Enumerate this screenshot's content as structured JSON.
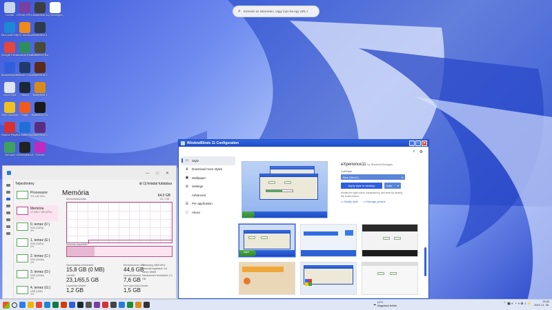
{
  "desktop": {
    "icons": [
      {
        "label": "Lomtár",
        "color": "#c9d6ea",
        "col": 0,
        "row": 0
      },
      {
        "label": "CPUID CPU-Z",
        "color": "#7a3fa0",
        "col": 1,
        "row": 0
      },
      {
        "label": "Battlefield 2",
        "color": "#3d3d3d",
        "col": 2,
        "row": 0
      },
      {
        "label": "Új Szöveges dokumentum",
        "color": "#ffffff",
        "col": 3,
        "row": 0
      },
      {
        "label": "Microsoft Edge",
        "color": "#1e88d6",
        "col": 0,
        "row": 1
      },
      {
        "label": "VLC media player",
        "color": "#f08a1d",
        "col": 1,
        "row": 1
      },
      {
        "label": "Battlefield 4",
        "color": "#2e3b4a",
        "col": 2,
        "row": 1
      },
      {
        "label": "Google Chrome",
        "color": "#e6453a",
        "col": 0,
        "row": 2
      },
      {
        "label": "Acrobat Reader",
        "color": "#2f8f5a",
        "col": 1,
        "row": 2
      },
      {
        "label": "Battlefield Bad Company",
        "color": "#4a4a3a",
        "col": 2,
        "row": 2
      },
      {
        "label": "Malwarebytes",
        "color": "#2f5fdc",
        "col": 0,
        "row": 3
      },
      {
        "label": "Ubisoft Connect",
        "color": "#1f3b6a",
        "col": 1,
        "row": 3
      },
      {
        "label": "Battlefield V",
        "color": "#5a2a1a",
        "col": 2,
        "row": 3
      },
      {
        "label": "Linux Mint",
        "color": "#dfe5ee",
        "col": 0,
        "row": 4
      },
      {
        "label": "Steam",
        "color": "#1b2838",
        "col": 1,
        "row": 4
      },
      {
        "label": "Battlefield 1",
        "color": "#d88a1a",
        "col": 2,
        "row": 4
      },
      {
        "label": "Stern Autoloader",
        "color": "#f0c020",
        "col": 0,
        "row": 5
      },
      {
        "label": "Origin",
        "color": "#f25a1b",
        "col": 1,
        "row": 5
      },
      {
        "label": "Battlefield 2042",
        "color": "#1a1a1a",
        "col": 2,
        "row": 5
      },
      {
        "label": "Roblox Player",
        "color": "#d93030",
        "col": 0,
        "row": 6
      },
      {
        "label": "EA Battlefront",
        "color": "#1f6fd6",
        "col": 1,
        "row": 6
      },
      {
        "label": "Battlefield V",
        "color": "#5b2d82",
        "col": 2,
        "row": 6
      },
      {
        "label": "Jail card",
        "color": "#3fa060",
        "col": 0,
        "row": 7
      },
      {
        "label": "Windowblinds",
        "color": "#222222",
        "col": 1,
        "row": 7
      },
      {
        "label": "Fences",
        "color": "#c02ac0",
        "col": 2,
        "row": 7
      }
    ]
  },
  "search": {
    "placeholder": "Keresés az interneten, vagy írjon be egy URL-t"
  },
  "taskmgr": {
    "title": "Teljesítmény",
    "run_task": "Új feladat futtatása",
    "items": [
      {
        "name": "Processzor",
        "sub1": "2%  4,82 GHz",
        "sub2": ""
      },
      {
        "name": "Memória",
        "sub1": "17,0/63,7 GB (27%)",
        "sub2": ""
      },
      {
        "name": "0. lemez (F:)",
        "sub1": "SSD (SATA)",
        "sub2": "0%"
      },
      {
        "name": "1. lemez (E:)",
        "sub1": "SSD (SATA)",
        "sub2": "0%"
      },
      {
        "name": "2. lemez (C:)",
        "sub1": "SSD (NVMe)",
        "sub2": "1%"
      },
      {
        "name": "3. lemez (D:)",
        "sub1": "SSD (NVMe)",
        "sub2": "0%"
      },
      {
        "name": "4. lemez (G:)",
        "sub1": "USB (USB)",
        "sub2": "0%"
      },
      {
        "name": "5. lemez (I:)",
        "sub1": "USB (USB)",
        "sub2": "0%"
      }
    ],
    "memory": {
      "heading": "Memória",
      "capacity": "64,0 GB",
      "graph_label": "Memóriahasználat",
      "graph_max": "61,7 GB",
      "composition": "Memória-összetétel",
      "stats": [
        {
          "k": "Használatban (tömörített)",
          "v": "15,8 GB (0 MB)"
        },
        {
          "k": "Rendelkezésre álló",
          "v": "44,6 GB"
        },
        {
          "k": "Lekötött",
          "v": "23,1/65,5 GB"
        },
        {
          "k": "Gyorsítótárazott",
          "v": "7,6 GB"
        },
        {
          "k": "Lapozható készlet",
          "v": "1,2 GB"
        },
        {
          "k": "Nem lapozható készlet",
          "v": "1,5 GB"
        }
      ],
      "right": [
        "Sebesség:  4800 MHz",
        "Használt foglalatok: 2/4",
        "Méret: DIMM",
        "Hardveresen fenntartott: 2,3 GB"
      ]
    }
  },
  "wb": {
    "title": "WindowBlinds 11 Configuration",
    "nav": [
      {
        "label": "Style",
        "icon": "▭",
        "selected": true
      },
      {
        "label": "Download more styles",
        "icon": "⬇"
      },
      {
        "label": "Wallpaper",
        "icon": "▣"
      },
      {
        "label": "Settings",
        "icon": "⚙"
      },
      {
        "label": "Advanced",
        "icon": "·"
      },
      {
        "label": "Per application",
        "icon": "☰"
      },
      {
        "label": "About",
        "icon": "ⓘ"
      }
    ],
    "style_name": "eXperience11",
    "style_by": "by Stardock/Designs",
    "substyle_label": "SubStyle",
    "substyle_value": "Blue (Win11)",
    "apply_label": "Apply style to desktop",
    "auto_label": "Auto",
    "description": "Modify the style colour, transparency and fonts by clicking the button below.",
    "modify_label": "Modify style",
    "manage_label": "Manage presets",
    "start_label": "start"
  },
  "taskbar": {
    "weather_temp": "12°C",
    "weather_desc": "Nagyrészt felhős",
    "time": "20:00",
    "date": "2023. 11. 06."
  }
}
